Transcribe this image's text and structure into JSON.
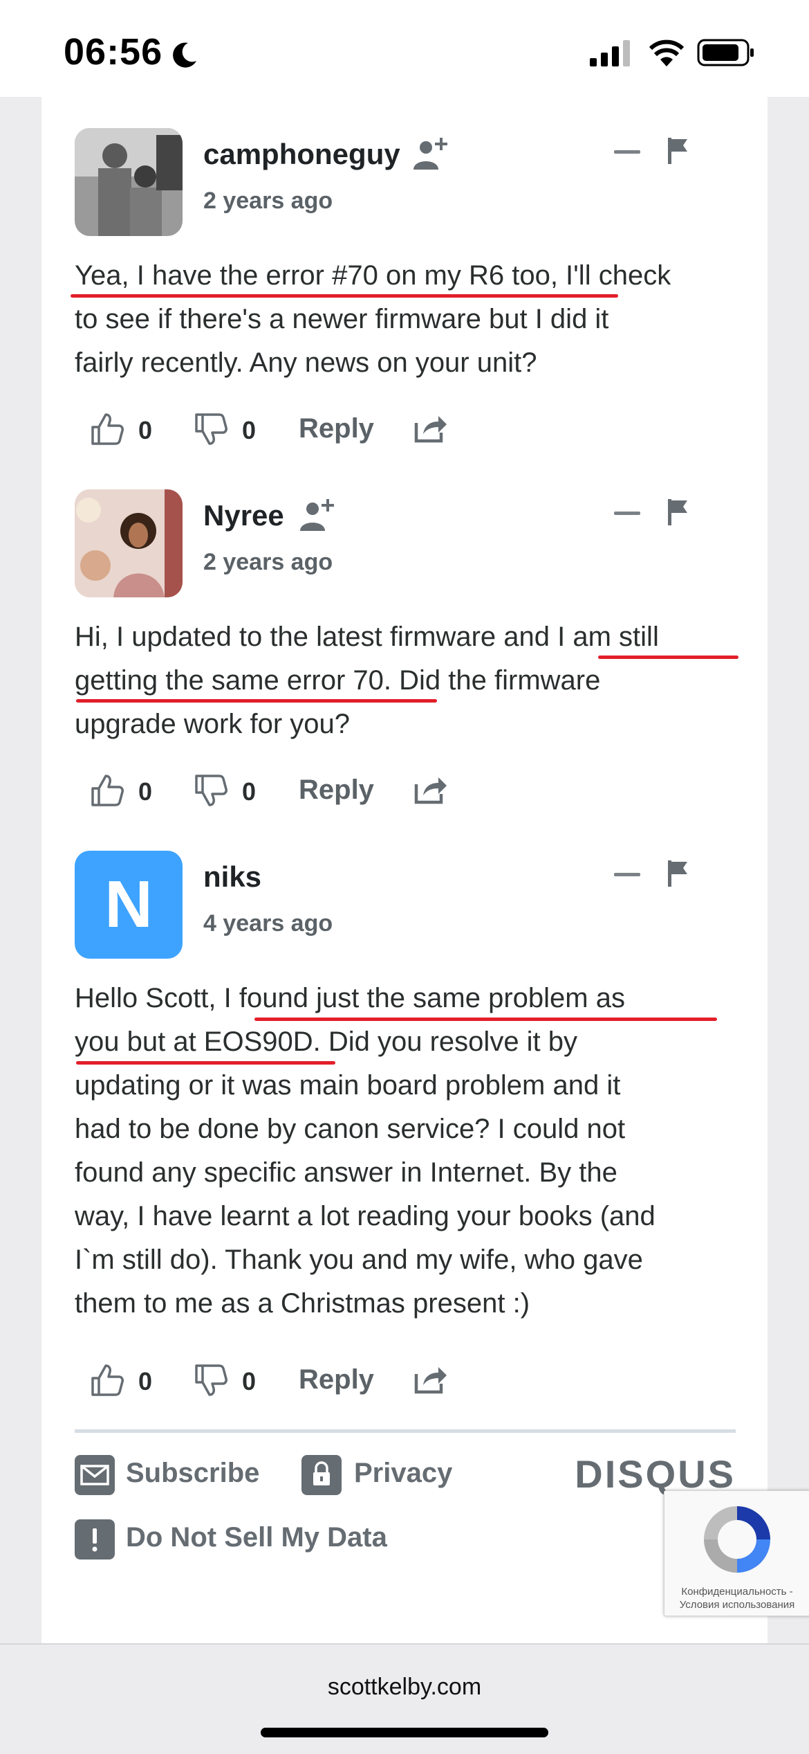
{
  "status_bar": {
    "time": "06:56"
  },
  "comments": [
    {
      "author": "camphoneguy",
      "time_ago": "2 years ago",
      "lines": [
        "Yea, I have the error #70 on my R6 too, I'll check",
        "to see if there's a newer firmware but I did it",
        "fairly recently. Any news on your unit?"
      ],
      "upvotes": "0",
      "downvotes": "0",
      "reply_label": "Reply"
    },
    {
      "author": "Nyree",
      "time_ago": "2 years ago",
      "lines": [
        "Hi, I updated to the latest firmware and I am still",
        "getting the same error 70. Did the firmware",
        "upgrade work for you?"
      ],
      "upvotes": "0",
      "downvotes": "0",
      "reply_label": "Reply"
    },
    {
      "author": "niks",
      "avatar_letter": "N",
      "time_ago": "4 years ago",
      "lines": [
        "Hello Scott, I found just the same problem as",
        "you but at EOS90D. Did you resolve it by",
        "updating or it was main board problem and it",
        "had to be done by canon service? I could not",
        "found any specific answer in Internet. By the",
        "way, I have learnt a lot reading your books (and",
        "I`m still do). Thank you and my wife, who gave",
        "them to me as a Christmas present :)"
      ],
      "upvotes": "0",
      "downvotes": "0",
      "reply_label": "Reply"
    }
  ],
  "footer": {
    "subscribe": "Subscribe",
    "privacy": "Privacy",
    "do_not_sell": "Do Not Sell My Data",
    "brand": "DISQUS"
  },
  "recaptcha": {
    "line1": "Конфиденциальность -",
    "line2": "Условия использования"
  },
  "browser": {
    "url": "scottkelby.com"
  },
  "colors": {
    "underline": "#e21f2a",
    "avatar_blue": "#3ea3ff",
    "muted": "#656c72"
  }
}
